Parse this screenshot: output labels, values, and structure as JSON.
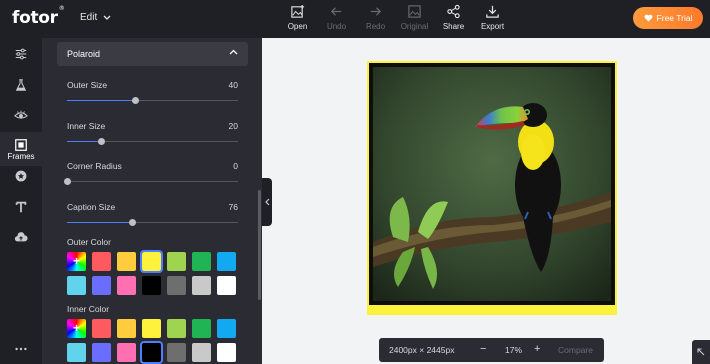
{
  "app": {
    "logo": "fotor",
    "logo_mark": "®",
    "edit_menu": "Edit"
  },
  "toolbar": [
    {
      "label": "Open",
      "icon": "image-plus-icon",
      "enabled": true
    },
    {
      "label": "Undo",
      "icon": "arrow-left-icon",
      "enabled": false
    },
    {
      "label": "Redo",
      "icon": "arrow-right-icon",
      "enabled": false
    },
    {
      "label": "Original",
      "icon": "image-icon",
      "enabled": false
    },
    {
      "label": "Share",
      "icon": "share-icon",
      "enabled": true
    },
    {
      "label": "Export",
      "icon": "download-icon",
      "enabled": true
    }
  ],
  "trial_button": {
    "label": "Free Trial",
    "icon": "heart-icon"
  },
  "leftnav": {
    "items": [
      {
        "icon": "sliders-icon"
      },
      {
        "icon": "flask-icon"
      },
      {
        "icon": "eye-icon"
      },
      {
        "icon": "frame-icon",
        "label": "Frames",
        "active": true
      },
      {
        "icon": "sticker-icon"
      },
      {
        "icon": "text-icon"
      },
      {
        "icon": "cloud-upload-icon"
      },
      {
        "icon": "more-icon"
      }
    ]
  },
  "panel": {
    "section_title": "Polaroid",
    "sliders": [
      {
        "label": "Outer Size",
        "value": "40",
        "fraction": 0.4
      },
      {
        "label": "Inner Size",
        "value": "20",
        "fraction": 0.2
      },
      {
        "label": "Corner Radius",
        "value": "0",
        "fraction": 0.0
      },
      {
        "label": "Caption Size",
        "value": "76",
        "fraction": 0.38
      }
    ],
    "outer_color": {
      "label": "Outer Color",
      "swatches": [
        "picker",
        "#ff5a5f",
        "#ffcc3e",
        "#fff23d",
        "#9ed44f",
        "#21b455",
        "#13a9f0",
        "#62d3ec",
        "#6b6dff",
        "#ff6fb2",
        "#000000",
        "#6e6e6e",
        "#c9c9c9",
        "#ffffff"
      ],
      "selected": 3
    },
    "inner_color": {
      "label": "Inner Color",
      "swatches": [
        "picker",
        "#ff5a5f",
        "#ffcc3e",
        "#fff23d",
        "#9ed44f",
        "#21b455",
        "#13a9f0",
        "#62d3ec",
        "#6b6dff",
        "#ff6fb2",
        "#000000",
        "#6e6e6e",
        "#c9c9c9",
        "#ffffff"
      ],
      "selected": 10
    }
  },
  "canvas": {
    "dimensions": "2400px × 2445px",
    "zoom": "17%",
    "zoom_minus": "−",
    "zoom_plus": "+",
    "compare": "Compare"
  }
}
